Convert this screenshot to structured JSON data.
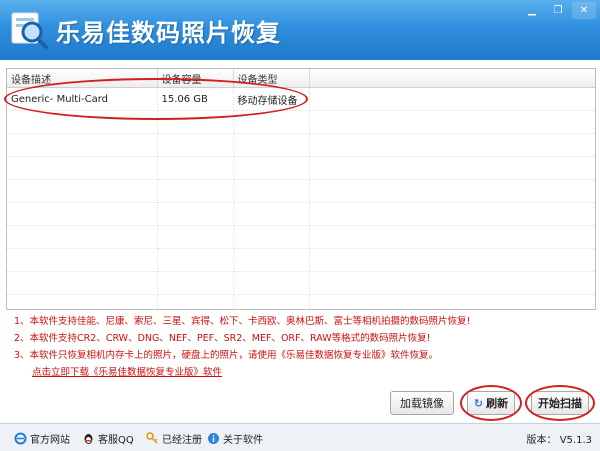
{
  "window": {
    "title": "乐易佳数码照片恢复",
    "controls": [
      "minimize-icon",
      "maximize-icon",
      "close-icon"
    ]
  },
  "table": {
    "headers": [
      "设备描述",
      "设备容量",
      "设备类型"
    ],
    "rows": [
      [
        "Generic- Multi-Card",
        "15.06 GB",
        "移动存储设备"
      ]
    ],
    "empty_row_count": 9
  },
  "notes": {
    "lines": [
      "1、本软件支持佳能、尼康、索尼、三星、宾得、松下、卡西欧、奥林巴斯、富士等相机拍摄的数码照片恢复!",
      "2、本软件支持CR2、CRW、DNG、NEF、PEF、SR2、MEF、ORF、RAW等格式的数码照片恢复!",
      "3、本软件只恢复相机内存卡上的照片，硬盘上的照片，请使用《乐易佳数据恢复专业版》软件恢复。"
    ],
    "link": "点击立即下载《乐易佳数据恢复专业版》软件"
  },
  "buttons": {
    "load_image": "加载镜像",
    "refresh": "刷新",
    "start_scan": "开始扫描"
  },
  "statusbar": {
    "items": [
      "官方网站",
      "客服QQ",
      "已经注册",
      "关于软件"
    ],
    "icons": [
      "ie-icon",
      "qq-penguin-icon",
      "key-icon",
      "info-icon"
    ],
    "version": "版本： V5.1.3"
  },
  "colors": {
    "title_bar": "#2f8fde",
    "note_text": "#d10e0e",
    "annotation_ring": "#d21f1f"
  }
}
